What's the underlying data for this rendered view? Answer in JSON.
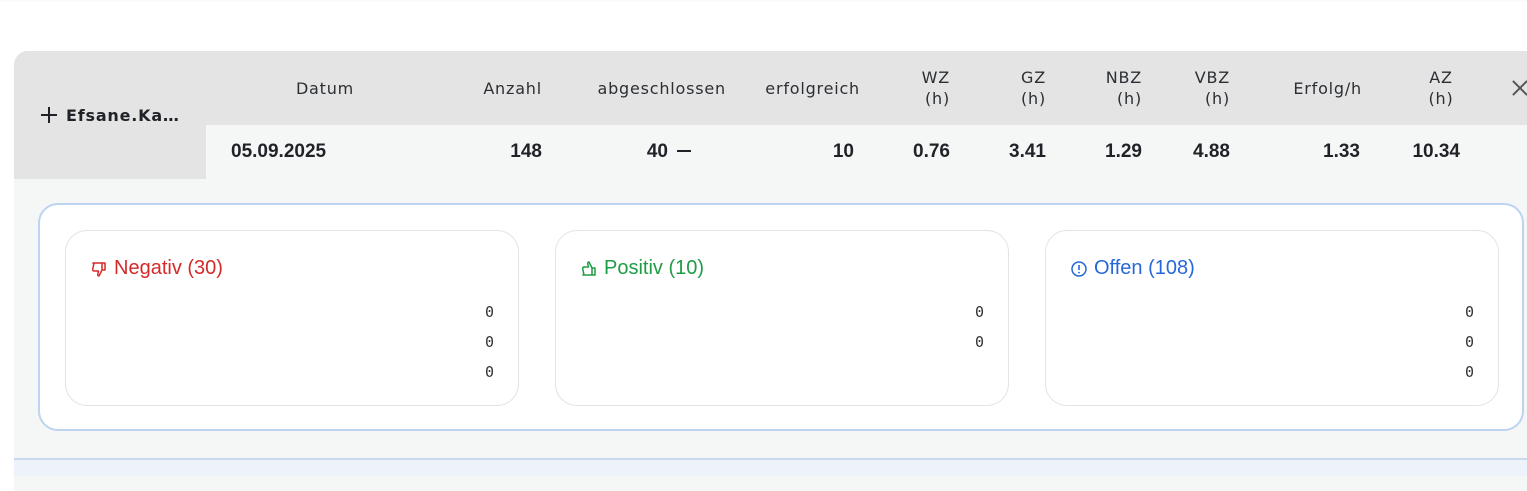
{
  "user": {
    "name": "Efsane.Ka…"
  },
  "columns": [
    {
      "key": "datum",
      "label": "Datum",
      "unit": ""
    },
    {
      "key": "anzahl",
      "label": "Anzahl",
      "unit": ""
    },
    {
      "key": "abgeschlossen",
      "label": "abgeschlossen",
      "unit": ""
    },
    {
      "key": "erfolgreich",
      "label": "erfolgreich",
      "unit": ""
    },
    {
      "key": "wz",
      "label": "WZ",
      "unit": "(h)"
    },
    {
      "key": "gz",
      "label": "GZ",
      "unit": "(h)"
    },
    {
      "key": "nbz",
      "label": "NBZ",
      "unit": "(h)"
    },
    {
      "key": "vbz",
      "label": "VBZ",
      "unit": "(h)"
    },
    {
      "key": "erfolg_h",
      "label": "Erfolg/h",
      "unit": ""
    },
    {
      "key": "az",
      "label": "AZ",
      "unit": "(h)"
    }
  ],
  "row": {
    "datum": "05.09.2025",
    "anzahl": "148",
    "abgeschlossen": "40",
    "erfolgreich": "10",
    "wz": "0.76",
    "gz": "3.41",
    "nbz": "1.29",
    "vbz": "4.88",
    "erfolg_h": "1.33",
    "az": "10.34"
  },
  "groups": [
    {
      "key": "negativ",
      "title": "Negativ (30)",
      "icon": "thumbs-down-icon",
      "color": "#d42a2a",
      "values": [
        "0",
        "0",
        "0"
      ]
    },
    {
      "key": "positiv",
      "title": "Positiv (10)",
      "icon": "thumbs-up-icon",
      "color": "#1e9c46",
      "values": [
        "0",
        "0"
      ]
    },
    {
      "key": "offen",
      "title": "Offen (108)",
      "icon": "info-circle-icon",
      "color": "#2668d8",
      "values": [
        "0",
        "0",
        "0"
      ]
    }
  ]
}
